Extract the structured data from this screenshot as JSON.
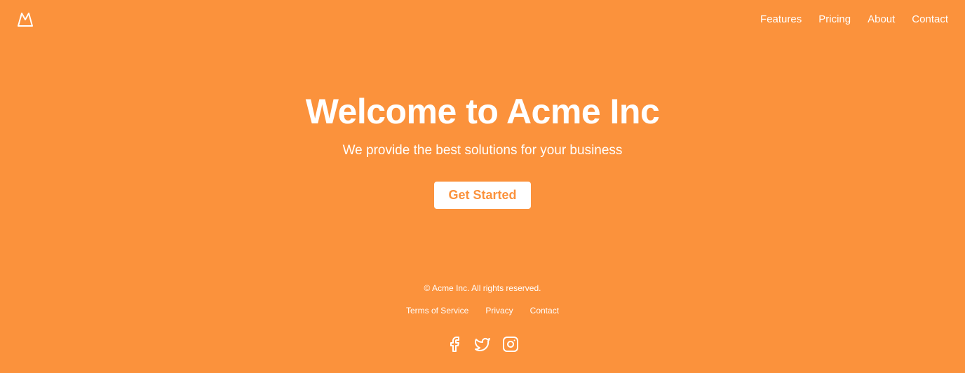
{
  "header": {
    "logo_icon": "mountain-icon",
    "nav": [
      "Features",
      "Pricing",
      "About",
      "Contact"
    ]
  },
  "hero": {
    "title": "Welcome to Acme Inc",
    "subtitle": "We provide the best solutions for your business",
    "cta_label": "Get Started"
  },
  "footer": {
    "copyright": "© Acme Inc. All rights reserved.",
    "links": [
      "Terms of Service",
      "Privacy",
      "Contact"
    ],
    "social_icons": [
      "facebook-icon",
      "twitter-icon",
      "instagram-icon"
    ]
  },
  "colors": {
    "background": "#fb923c",
    "text": "#ffffff",
    "cta_background": "#ffffff",
    "cta_text": "#fb923c"
  }
}
